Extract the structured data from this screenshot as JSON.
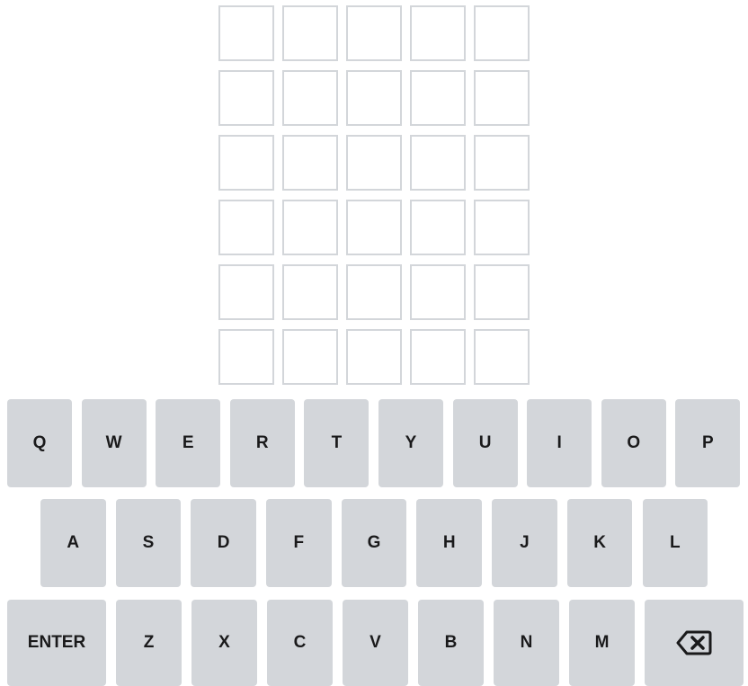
{
  "board": {
    "rows": [
      [
        "",
        "",
        "",
        "",
        ""
      ],
      [
        "",
        "",
        "",
        "",
        ""
      ],
      [
        "",
        "",
        "",
        "",
        ""
      ],
      [
        "",
        "",
        "",
        "",
        ""
      ],
      [
        "",
        "",
        "",
        "",
        ""
      ],
      [
        "",
        "",
        "",
        "",
        ""
      ]
    ]
  },
  "keyboard": {
    "row1": [
      "Q",
      "W",
      "E",
      "R",
      "T",
      "Y",
      "U",
      "I",
      "O",
      "P"
    ],
    "row2": [
      "A",
      "S",
      "D",
      "F",
      "G",
      "H",
      "J",
      "K",
      "L"
    ],
    "row3": [
      "Z",
      "X",
      "C",
      "V",
      "B",
      "N",
      "M"
    ],
    "enter_label": "ENTER",
    "backspace_icon": "backspace-icon"
  },
  "colors": {
    "tile_border": "#d3d6da",
    "key_bg": "#d3d6da",
    "text": "#1a1a1b"
  }
}
